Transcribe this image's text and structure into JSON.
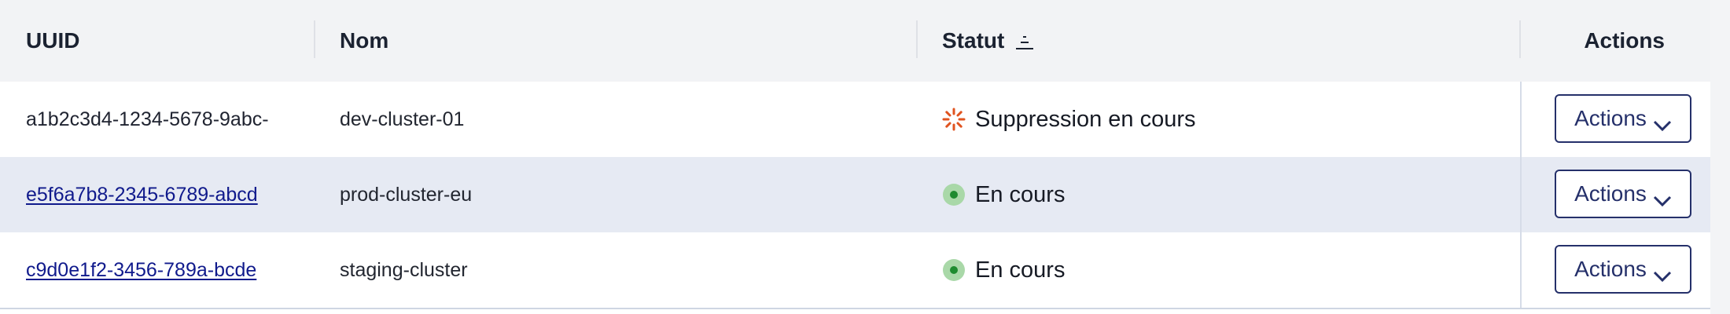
{
  "header": {
    "uuid": "UUID",
    "nom": "Nom",
    "statut": "Statut",
    "actions": "Actions"
  },
  "rows": [
    {
      "uuid": "a1b2c3d4-1234-5678-9abc-",
      "uuid_link": false,
      "nom": "dev-cluster-01",
      "statut": "Suppression en cours",
      "status_icon": "spinner-icon",
      "status_color": "#e0531f",
      "actions_label": "Actions"
    },
    {
      "uuid": "e5f6a7b8-2345-6789-abcd",
      "uuid_link": true,
      "nom": "prod-cluster-eu",
      "statut": "En cours",
      "status_icon": "running-dot-icon",
      "status_color": "#1e8b2f",
      "actions_label": "Actions"
    },
    {
      "uuid": "c9d0e1f2-3456-789a-bcde",
      "uuid_link": true,
      "nom": "staging-cluster",
      "statut": "En cours",
      "status_icon": "running-dot-icon",
      "status_color": "#1e8b2f",
      "actions_label": "Actions"
    }
  ],
  "colors": {
    "header_bg": "#f2f3f5",
    "selected_row_bg": "#e6eaf3",
    "link": "#101a8c",
    "button_border": "#25306a"
  }
}
